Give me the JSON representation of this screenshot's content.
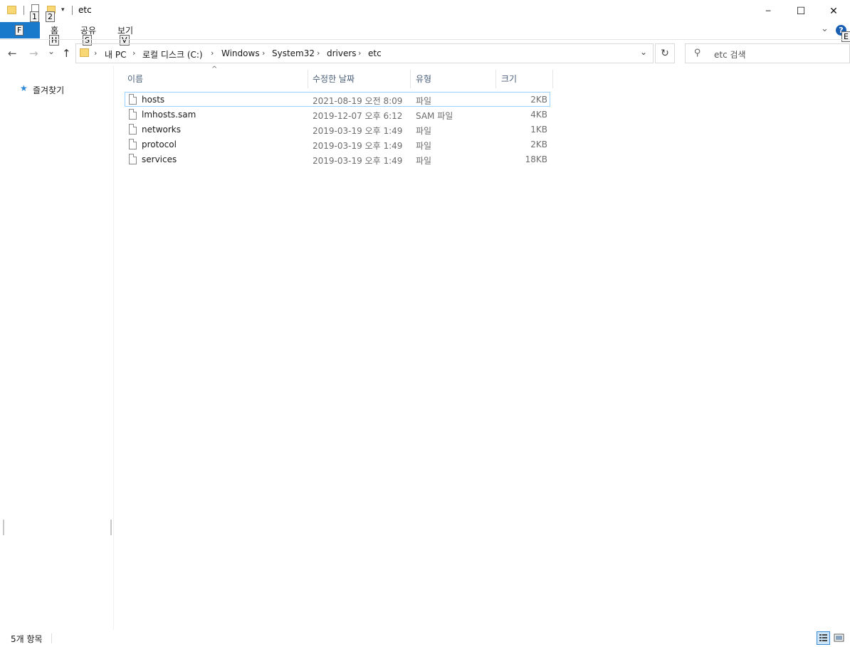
{
  "window": {
    "title": "etc",
    "minimize": "─",
    "maximize": "☐",
    "close": "✕"
  },
  "quick_access": {
    "keytip_1": "1",
    "keytip_2": "2",
    "dropdown": "▾"
  },
  "ribbon": {
    "file_keytip": "F",
    "tabs": [
      {
        "label": "홈",
        "keytip": "H"
      },
      {
        "label": "공유",
        "keytip": "S"
      },
      {
        "label": "보기",
        "keytip": "V"
      }
    ],
    "collapse": "⌄",
    "help_icon": "?",
    "help_keytip": "E"
  },
  "nav": {
    "back": "←",
    "forward": "→",
    "recent": "⌄",
    "up": "↑",
    "refresh": "↻",
    "dropdown": "⌄"
  },
  "address": {
    "crumbs": [
      "내 PC",
      "로컬 디스크 (C:)",
      "Windows",
      "System32",
      "drivers",
      "etc"
    ],
    "separator": "›"
  },
  "search": {
    "placeholder": "etc 검색",
    "icon": "search-icon"
  },
  "sidebar": {
    "favorites_label": "즐겨찾기",
    "favorites_icon": "★"
  },
  "columns": {
    "name": "이름",
    "modified": "수정한 날짜",
    "type": "유형",
    "size": "크기",
    "sort_arrow": "^"
  },
  "files": [
    {
      "name": "hosts",
      "modified": "2021-08-19 오전 8:09",
      "type": "파일",
      "size": "2KB",
      "selected": true
    },
    {
      "name": "lmhosts.sam",
      "modified": "2019-12-07 오후 6:12",
      "type": "SAM 파일",
      "size": "4KB",
      "selected": false
    },
    {
      "name": "networks",
      "modified": "2019-03-19 오후 1:49",
      "type": "파일",
      "size": "1KB",
      "selected": false
    },
    {
      "name": "protocol",
      "modified": "2019-03-19 오후 1:49",
      "type": "파일",
      "size": "2KB",
      "selected": false
    },
    {
      "name": "services",
      "modified": "2019-03-19 오후 1:49",
      "type": "파일",
      "size": "18KB",
      "selected": false
    }
  ],
  "status": {
    "item_count": "5개 항목"
  },
  "colors": {
    "file_tab": "#1979ca",
    "selection_border": "#99d1ff",
    "header_text": "#4c607a"
  }
}
